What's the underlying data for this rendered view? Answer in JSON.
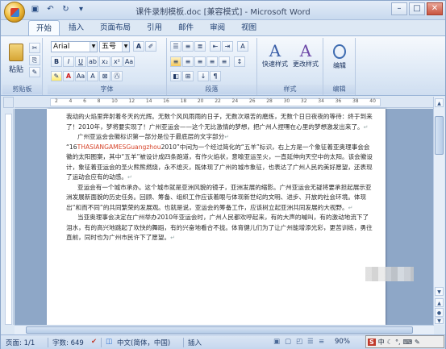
{
  "title": "课件录制模板.doc [兼容模式] - Microsoft Word",
  "tabs": [
    "开始",
    "插入",
    "页面布局",
    "引用",
    "邮件",
    "审阅",
    "视图"
  ],
  "ribbon": {
    "groups": {
      "clipboard": "剪贴板",
      "font": "字体",
      "paragraph": "段落",
      "styles": "样式",
      "editing": "编辑"
    },
    "paste_label": "粘贴",
    "font_name": "Arial",
    "font_size": "五号",
    "quick_style": "快速样式",
    "change_style": "更改样式",
    "edit_label": "编辑"
  },
  "ruler_numbers": [
    "2",
    "4",
    "6",
    "8",
    "10",
    "12",
    "14",
    "16",
    "18",
    "20",
    "22",
    "24",
    "26",
    "28",
    "30",
    "32",
    "34",
    "36",
    "38",
    "40"
  ],
  "document": {
    "p1": "我动的火焰里奔射着冬天的光辉。无数个风风雨雨的日子，无数次艰苦的磨炼，无数个日日夜夜的等待：终于到来了！2010年，梦将要实现了！广州亚运会——这个无比激情的梦想，把广州人捏嘿在心里的梦想激发出来了。",
    "p2": "广州亚运会会徽标识第一部分是位于最底层的文字部分",
    "p3_pre": "“16",
    "p3_highlight": "THASIANGAMESGuangzhou",
    "p3_post": "2010”中间为一个经过简化的“五羊”标识，右上方是一个象征着亚奥理事会会徽的太阳图案，其中“五羊”被设计成四条跑道，有作火焰状，意喻亚运圣火，一直延伸向天空中的太阳。该会徽设计，象征着亚运会的圣火熊熊燃烧，永不熄灭，既体现了广州的城市象征，也表达了广州人民的美好愿望，还表现了运动会应有的动感。",
    "p4": "亚运会有一个城市承办。这个城市就是亚洲风貌的镜子，亚洲发展的缩影。广州亚运会无疑将要承担起展示亚洲发展新面貌的历史任务。回顾、筹备、组织工作应该着眼与体现新世纪的文明、进步、开放的社会环境。体现出“和而不同”的共同繁荣的发展观。也就是说，亚运会的筹备工作，应该树立起亚洲共同发展的大视野。",
    "p5": "当亚奥理事会决定在广州举办2010年亚运会时，广州人民都欢呼起来，有的大声的喊叫，有的激动地流下了泪水，有的高兴地跳起了欢快的舞蹈，有的兴奋地看合不拢。体育健儿们为了让广州能增添光彩，更苦训练，勇往直前，同时也为广州市民许下了愿望。"
  },
  "status": {
    "page": "页面: 1/1",
    "words": "字数: 649",
    "lang": "中文(简体，中国)",
    "mode": "插入",
    "zoom": "90%"
  },
  "ime": "中"
}
